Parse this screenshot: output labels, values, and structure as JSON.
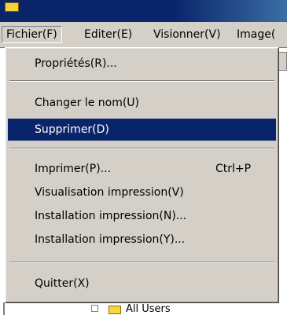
{
  "window": {
    "title": ""
  },
  "menubar": {
    "items": [
      {
        "label": "Fichier(F)"
      },
      {
        "label": "Editer(E)"
      },
      {
        "label": "Visionner(V)"
      },
      {
        "label": "Image("
      }
    ]
  },
  "file_menu": {
    "items": [
      {
        "label": "Propriétés(R)..."
      },
      {
        "label": "Changer le nom(U)"
      },
      {
        "label": "Supprimer(D)",
        "highlighted": true
      },
      {
        "label": "Imprimer(P)...",
        "shortcut": "Ctrl+P"
      },
      {
        "label": "Visualisation impression(V)"
      },
      {
        "label": "Installation impression(N)..."
      },
      {
        "label": "Installation impression(Y)..."
      },
      {
        "label": "Quitter(X)"
      }
    ]
  },
  "tree": {
    "partial_label": "All Users"
  },
  "colors": {
    "menu_bg": "#d4d0c8",
    "highlight": "#0a246a",
    "title_bar": "#0a246a"
  }
}
